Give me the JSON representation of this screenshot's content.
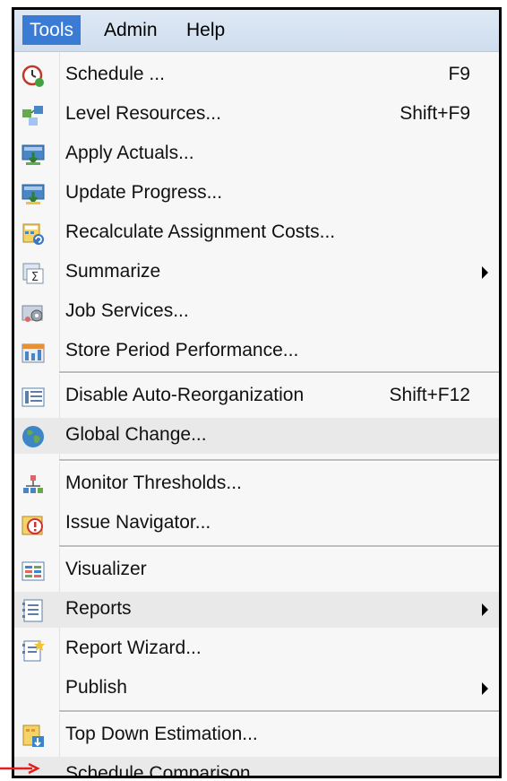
{
  "menubar": {
    "tools": "Tools",
    "admin": "Admin",
    "help": "Help"
  },
  "menu": {
    "schedule": {
      "label": "Schedule ...",
      "shortcut": "F9"
    },
    "level_resources": {
      "label": "Level Resources...",
      "shortcut": "Shift+F9"
    },
    "apply_actuals": {
      "label": "Apply Actuals..."
    },
    "update_progress": {
      "label": "Update Progress..."
    },
    "recalculate_costs": {
      "label": "Recalculate Assignment Costs..."
    },
    "summarize": {
      "label": "Summarize"
    },
    "job_services": {
      "label": "Job Services..."
    },
    "store_period": {
      "label": "Store Period Performance..."
    },
    "disable_reorg": {
      "label": "Disable Auto-Reorganization",
      "shortcut": "Shift+F12"
    },
    "global_change": {
      "label": "Global Change..."
    },
    "monitor_thresholds": {
      "label": "Monitor Thresholds..."
    },
    "issue_navigator": {
      "label": "Issue Navigator..."
    },
    "visualizer": {
      "label": "Visualizer"
    },
    "reports": {
      "label": "Reports"
    },
    "report_wizard": {
      "label": "Report Wizard..."
    },
    "publish": {
      "label": "Publish"
    },
    "top_down": {
      "label": "Top Down Estimation..."
    },
    "schedule_comparison": {
      "label": "Schedule Comparison"
    }
  },
  "colors": {
    "menubar_active": "#3a7bd5",
    "highlight": "#e9e9e9",
    "pointer_arrow": "#e02020"
  }
}
